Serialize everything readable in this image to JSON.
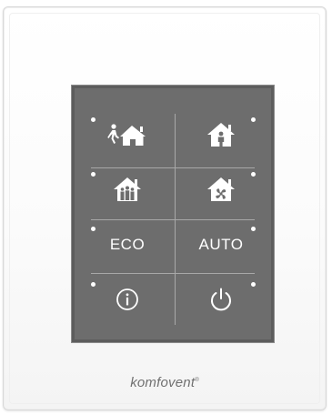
{
  "device": {
    "brand": "komfovent",
    "brand_mark": "®"
  },
  "panel": {
    "buttons": [
      {
        "id": "away",
        "icon": "person-walking-away-house-icon",
        "label": ""
      },
      {
        "id": "home",
        "icon": "person-at-home-icon",
        "label": ""
      },
      {
        "id": "party",
        "icon": "people-in-house-icon",
        "label": ""
      },
      {
        "id": "ventilation",
        "icon": "fan-in-house-icon",
        "label": ""
      },
      {
        "id": "eco",
        "icon": "",
        "label": "ECO"
      },
      {
        "id": "auto",
        "icon": "",
        "label": "AUTO"
      },
      {
        "id": "info",
        "icon": "info-icon",
        "label": ""
      },
      {
        "id": "power",
        "icon": "power-icon",
        "label": ""
      }
    ]
  },
  "colors": {
    "screen": "#6d6d6d",
    "screen_border": "#5d5d5d",
    "icon": "#ffffff",
    "brand_text": "#707070"
  }
}
